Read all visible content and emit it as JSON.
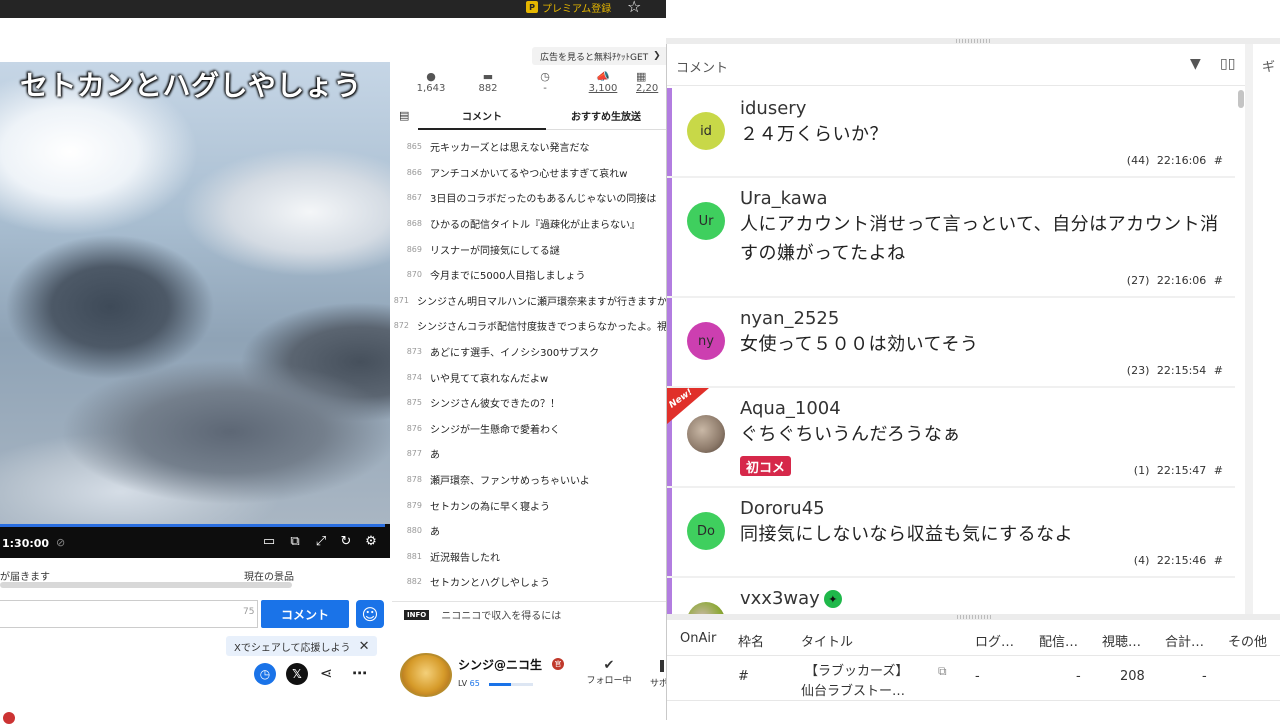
{
  "topbar": {
    "premium_label": "プレミアム登録",
    "premium_badge": "P"
  },
  "ad_banner": {
    "label": "広告を見ると無料ﾁｹｯﾄGET",
    "arrow": "❯"
  },
  "video": {
    "title": "セトカンとハグしやしょう",
    "time": "1:30:00"
  },
  "stats": [
    {
      "icon": "person-icon",
      "value": "1,643"
    },
    {
      "icon": "comment-icon",
      "value": "882"
    },
    {
      "icon": "clock-icon",
      "value": "-"
    },
    {
      "icon": "ad-icon",
      "value": "3,100"
    },
    {
      "icon": "gift-icon",
      "value": "2,20"
    }
  ],
  "tabs": {
    "comment": "コメント",
    "recommended": "おすすめ生放送"
  },
  "nico_comments": [
    {
      "no": "865",
      "text": "元キッカーズとは思えない発言だな"
    },
    {
      "no": "866",
      "text": "アンチコメかいてるやつ心せますぎて哀れw"
    },
    {
      "no": "867",
      "text": "3日目のコラボだったのもあるんじゃないの同接は"
    },
    {
      "no": "868",
      "text": "ひかるの配信タイトル『過疎化が止まらない』"
    },
    {
      "no": "869",
      "text": "リスナーが同接気にしてる謎"
    },
    {
      "no": "870",
      "text": "今月までに5000人目指しましょう"
    },
    {
      "no": "871",
      "text": "シンジさん明日マルハンに瀬戸環奈来ますが行きますか"
    },
    {
      "no": "872",
      "text": "シンジさんコラボ配信忖度抜きでつまらなかったよ。視"
    },
    {
      "no": "873",
      "text": "あどにす選手、イノシシ300サブスク"
    },
    {
      "no": "874",
      "text": "いや見てて哀れなんだよw"
    },
    {
      "no": "875",
      "text": "シンジさん彼女できたの？！"
    },
    {
      "no": "876",
      "text": "シンジが一生懸命で愛着わく"
    },
    {
      "no": "877",
      "text": "あ"
    },
    {
      "no": "878",
      "text": "瀬戸環奈、ファンサめっちゃいいよ"
    },
    {
      "no": "879",
      "text": "セトカンの為に早く寝よう"
    },
    {
      "no": "880",
      "text": "あ"
    },
    {
      "no": "881",
      "text": "近況報告したれ"
    },
    {
      "no": "882",
      "text": "セトカンとハグしやしょう"
    }
  ],
  "info_row": {
    "badge": "INFO",
    "text": "ニコニコで収入を得るには"
  },
  "gift": {
    "text": "が届きます",
    "now": "現在の景品"
  },
  "comment_form": {
    "placeholder": "",
    "count": "75",
    "send_label": "コメント"
  },
  "share_tip": {
    "text": "Xでシェアして応援しよう",
    "close": "✕"
  },
  "broadcaster": {
    "name": "シンジ@ニコ生",
    "lv_label": "LV",
    "lv": "65",
    "level_fraction": 0.5,
    "follow_label": "フォロー中",
    "support_partial": "サポ"
  },
  "panel": {
    "title": "コメント",
    "gift_tab": "ギ"
  },
  "comments": [
    {
      "avatar": "id",
      "color": "#c8d848",
      "user": "idusery",
      "text": "２４万くらいか？",
      "count": "(44)",
      "time": "22:16:06",
      "hash": "#"
    },
    {
      "avatar": "Ur",
      "color": "#3fcf5e",
      "user": "Ura_kawa",
      "text": "人にアカウント消せって言っといて、自分はアカウント消すの嫌がってたよね",
      "count": "(27)",
      "time": "22:16:06",
      "hash": "#"
    },
    {
      "avatar": "ny",
      "color": "#cc3fb0",
      "user": "nyan_2525",
      "text": "女使って５００は効いてそう",
      "count": "(23)",
      "time": "22:15:54",
      "hash": "#"
    },
    {
      "avatar": "",
      "color": "#8d7a6a",
      "user": "Aqua_1004",
      "text": "ぐちぐちいうんだろうなぁ",
      "badge": "初コメ",
      "new_label": "New!",
      "count": "(1)",
      "time": "22:15:47",
      "hash": "#"
    },
    {
      "avatar": "Do",
      "color": "#3fcf5e",
      "user": "Dororu45",
      "text": "同接気にしないなら収益も気にするなよ",
      "count": "(4)",
      "time": "22:15:46",
      "hash": "#"
    },
    {
      "avatar": "",
      "color": "#8aa832",
      "user": "vxx3way",
      "text": "",
      "count": "",
      "time": "",
      "hash": ""
    }
  ],
  "programs": {
    "headers": [
      "OnAir",
      "枠名",
      "タイトル",
      "ログ…",
      "配信…",
      "視聴…",
      "合計…",
      "その他"
    ],
    "row": {
      "frame": "#",
      "title_line1": "【ラブッカーズ】",
      "title_line2": "仙台ラブストー…",
      "log": "-",
      "stream": "-",
      "viewers": "208",
      "total": "-"
    }
  }
}
